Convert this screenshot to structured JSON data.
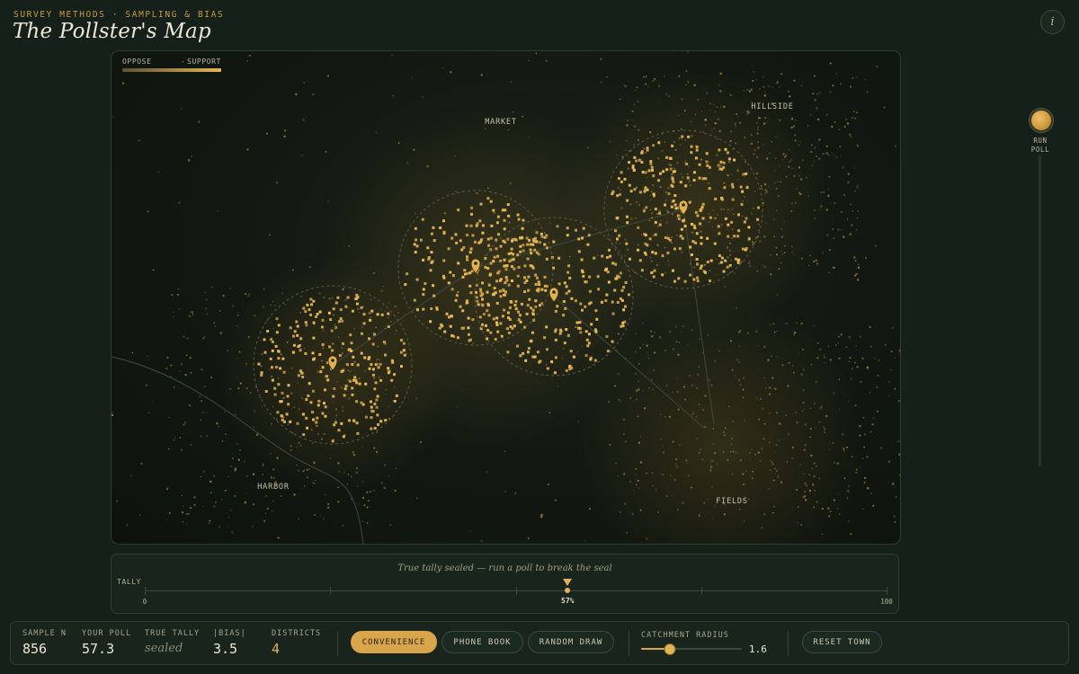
{
  "header": {
    "kicker": "SURVEY METHODS · SAMPLING & BIAS",
    "title": "The Pollster's Map",
    "info_icon": "i"
  },
  "map": {
    "legend": {
      "low": "OPPOSE",
      "high": "SUPPORT",
      "colors": [
        "#5d5236",
        "#e8b45a"
      ]
    },
    "districts": [
      "MARKET",
      "HILLSIDE",
      "HARBOR",
      "FIELDS"
    ],
    "accent_color": "#e2b257"
  },
  "run_poll": {
    "label_line1": "RUN",
    "label_line2": "POLL"
  },
  "tally": {
    "message": "True tally sealed — run a poll to break the seal",
    "label": "TALLY",
    "min": "0",
    "max": "100",
    "value_label": "57%",
    "value": 57
  },
  "stats": {
    "sample_n": {
      "label": "SAMPLE N",
      "value": "856"
    },
    "your_poll": {
      "label": "YOUR POLL",
      "value": "57.3"
    },
    "true_tally": {
      "label": "TRUE TALLY",
      "value": "sealed"
    },
    "bias": {
      "label": "|BIAS|",
      "value": "3.5"
    },
    "districts": {
      "label": "DISTRICTS",
      "value": "4"
    }
  },
  "methods": [
    {
      "label": "CONVENIENCE",
      "active": true
    },
    {
      "label": "PHONE BOOK",
      "active": false
    },
    {
      "label": "RANDOM DRAW",
      "active": false
    }
  ],
  "catchment": {
    "label": "CATCHMENT RADIUS",
    "value": "1.6",
    "fraction": 0.29
  },
  "reset": {
    "label": "RESET TOWN"
  }
}
